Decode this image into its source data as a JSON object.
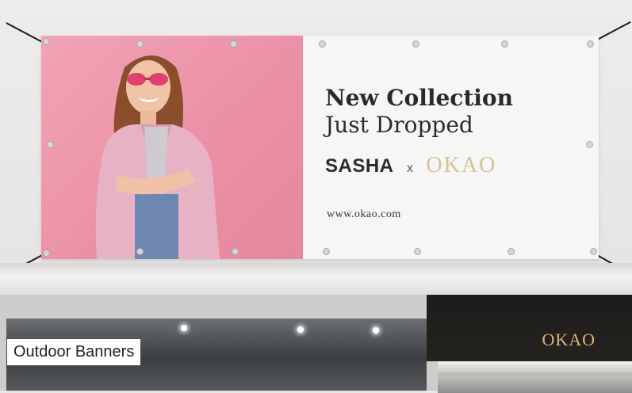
{
  "banner": {
    "headline": "New Collection",
    "subline": "Just Dropped",
    "brand_left": "SASHA",
    "brand_separator": "x",
    "brand_right": "OKAO",
    "website": "www.okao.com"
  },
  "storefront": {
    "sign_text": "OKAO"
  },
  "caption": "Outdoor Banners",
  "colors": {
    "photo_background": "#ee98ad",
    "gold_accent": "#d8c196",
    "sign_background": "#1d1c1a"
  }
}
